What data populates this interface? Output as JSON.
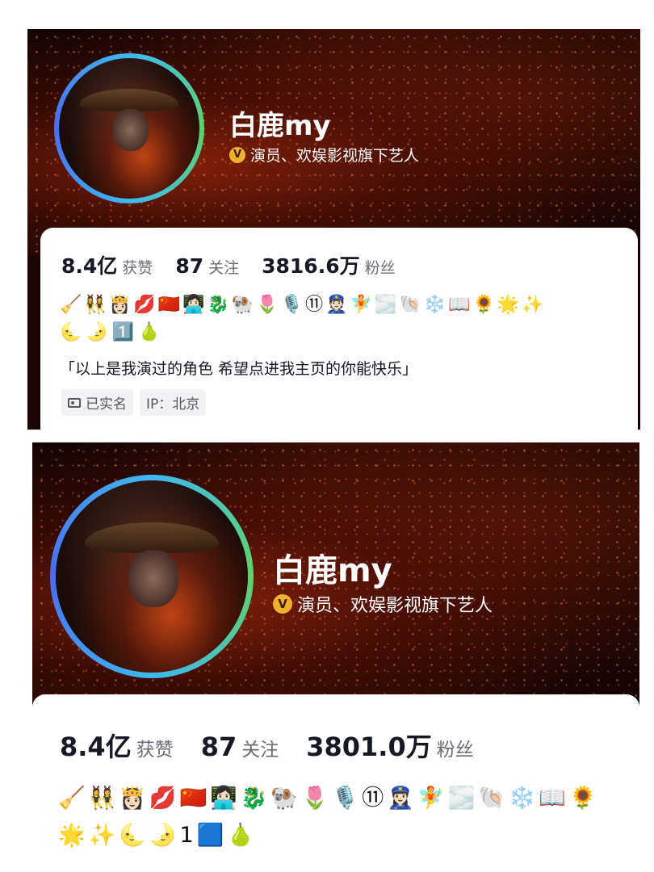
{
  "top": {
    "name": "白鹿my",
    "verified_icon": "verified-v-icon",
    "verified_mark": "V",
    "verified_text": "演员、欢娱影视旗下艺人",
    "stats": [
      {
        "num": "8.4亿",
        "label": "获赞"
      },
      {
        "num": "87",
        "label": "关注"
      },
      {
        "num": "3816.6万",
        "label": "粉丝"
      }
    ],
    "emoji_line1": [
      "🧹",
      "👯‍♀️",
      "👸🏻",
      "💋",
      "🇨🇳",
      "👩🏻‍💻",
      "🐉",
      "🐏",
      "🌷",
      "🎙️",
      "⑪",
      "👮🏻",
      "🧚",
      "🌫️",
      "🐚",
      "❄️",
      "📖",
      "🌻",
      "🌟",
      "✨"
    ],
    "emoji_line2": [
      "🌜",
      "🌛",
      "1️⃣",
      "🍐"
    ],
    "bio": "「以上是我演过的角色 希望点进我主页的你能快乐」",
    "chip_realname": "已实名",
    "chip_ip": "IP：北京"
  },
  "bottom": {
    "name": "白鹿my",
    "verified_mark": "V",
    "verified_text": "演员、欢娱影视旗下艺人",
    "stats": [
      {
        "num": "8.4亿",
        "label": "获赞"
      },
      {
        "num": "87",
        "label": "关注"
      },
      {
        "num": "3801.0万",
        "label": "粉丝"
      }
    ],
    "emoji_line1": [
      "🧹",
      "👯‍♀️",
      "👸🏻",
      "💋",
      "🇨🇳",
      "👩🏻‍💻",
      "🐉",
      "🐏",
      "🌷",
      "🎙️",
      "⑪",
      "👮🏻‍♀️",
      "🧚",
      "🌫️",
      "🐚",
      "❄️",
      "📖",
      "🌻"
    ],
    "emoji_line2": [
      "🌟",
      "✨",
      "🌜",
      "🌛",
      "1",
      "🟦",
      "🍐"
    ]
  }
}
